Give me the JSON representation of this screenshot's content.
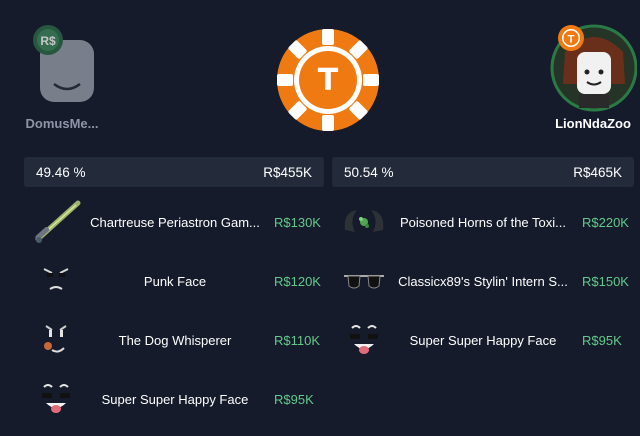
{
  "players": {
    "left": {
      "name": "DomusMe...",
      "badge": "R$"
    },
    "right": {
      "name": "LionNdaZoo",
      "badge": "T"
    }
  },
  "center_chip": {
    "letter": "T",
    "color": "#f07a12"
  },
  "stakes": {
    "left": {
      "percent": "49.46 %",
      "total": "R$455K"
    },
    "right": {
      "percent": "50.54 %",
      "total": "R$465K"
    }
  },
  "left_items": [
    {
      "name": "Chartreuse Periastron Gam...",
      "value": "R$130K",
      "icon": "sword-icon"
    },
    {
      "name": "Punk Face",
      "value": "R$120K",
      "icon": "punk-face-icon"
    },
    {
      "name": "The Dog Whisperer",
      "value": "R$110K",
      "icon": "dog-whisperer-face-icon"
    },
    {
      "name": "Super Super Happy Face",
      "value": "R$95K",
      "icon": "happy-face-icon"
    }
  ],
  "right_items": [
    {
      "name": "Poisoned Horns of the Toxi...",
      "value": "R$220K",
      "icon": "horns-icon"
    },
    {
      "name": "Classicx89's Stylin' Intern S...",
      "value": "R$150K",
      "icon": "sunglasses-icon"
    },
    {
      "name": "Super Super Happy Face",
      "value": "R$95K",
      "icon": "happy-face-icon"
    }
  ],
  "colors": {
    "background": "#151b2a",
    "bar": "#232b3b",
    "value_green": "#63c98a",
    "chip_orange": "#f07a12"
  }
}
